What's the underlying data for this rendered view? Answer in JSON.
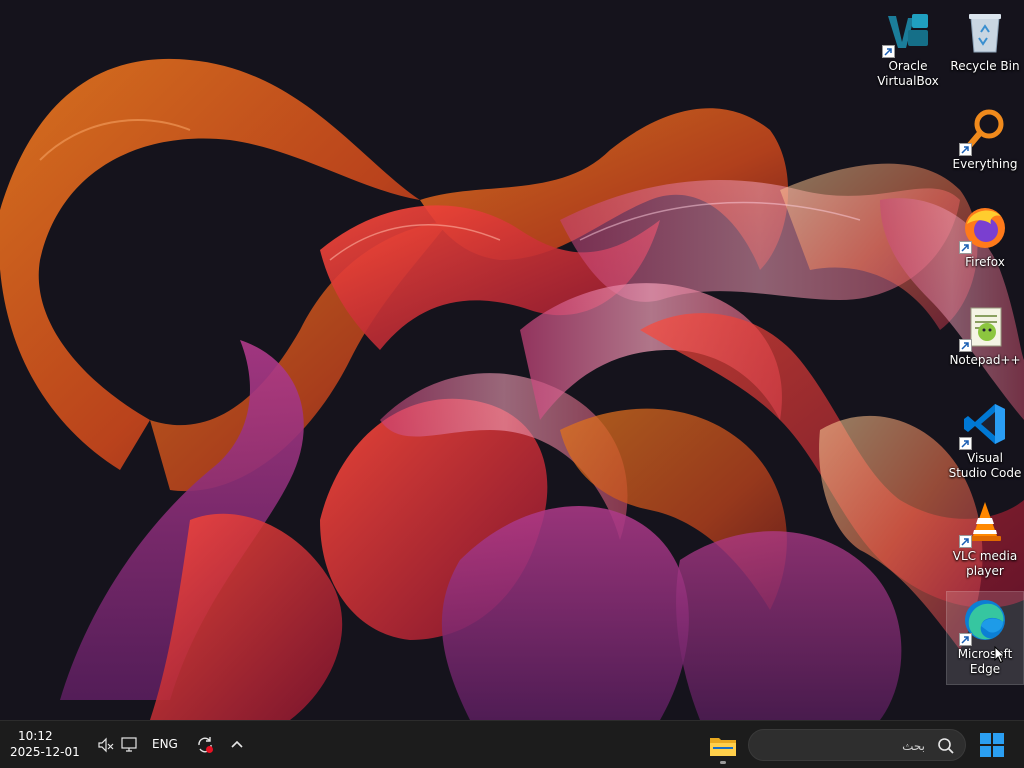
{
  "desktop": {
    "icons": [
      {
        "label": "Oracle VirtualBox",
        "icon": "virtualbox-icon"
      },
      {
        "label": "Recycle Bin",
        "icon": "recycle-bin-icon"
      },
      {
        "label": "Everything",
        "icon": "everything-search-icon"
      },
      {
        "label": "Firefox",
        "icon": "firefox-icon"
      },
      {
        "label": "Notepad++",
        "icon": "notepad-plus-plus-icon"
      },
      {
        "label": "Visual Studio Code",
        "icon": "vscode-icon"
      },
      {
        "label": "VLC media player",
        "icon": "vlc-icon"
      },
      {
        "label": "Microsoft Edge",
        "icon": "edge-icon"
      }
    ]
  },
  "taskbar": {
    "clock": {
      "time": "10:12",
      "date": "2025-12-01"
    },
    "tray": {
      "language": "ENG",
      "icons": [
        "volume-muted-icon",
        "network-icon",
        "sync-icon",
        "tray-overflow-chevron-icon"
      ]
    },
    "pinned": [
      {
        "icon": "file-explorer-icon",
        "running": true
      }
    ],
    "search": {
      "placeholder": "بحث"
    },
    "start": {
      "icon": "windows-start-icon"
    }
  },
  "colors": {
    "taskbar_bg": "#1c1c1c",
    "desktop_bg": "#15131c",
    "accent": "#0078d4"
  }
}
